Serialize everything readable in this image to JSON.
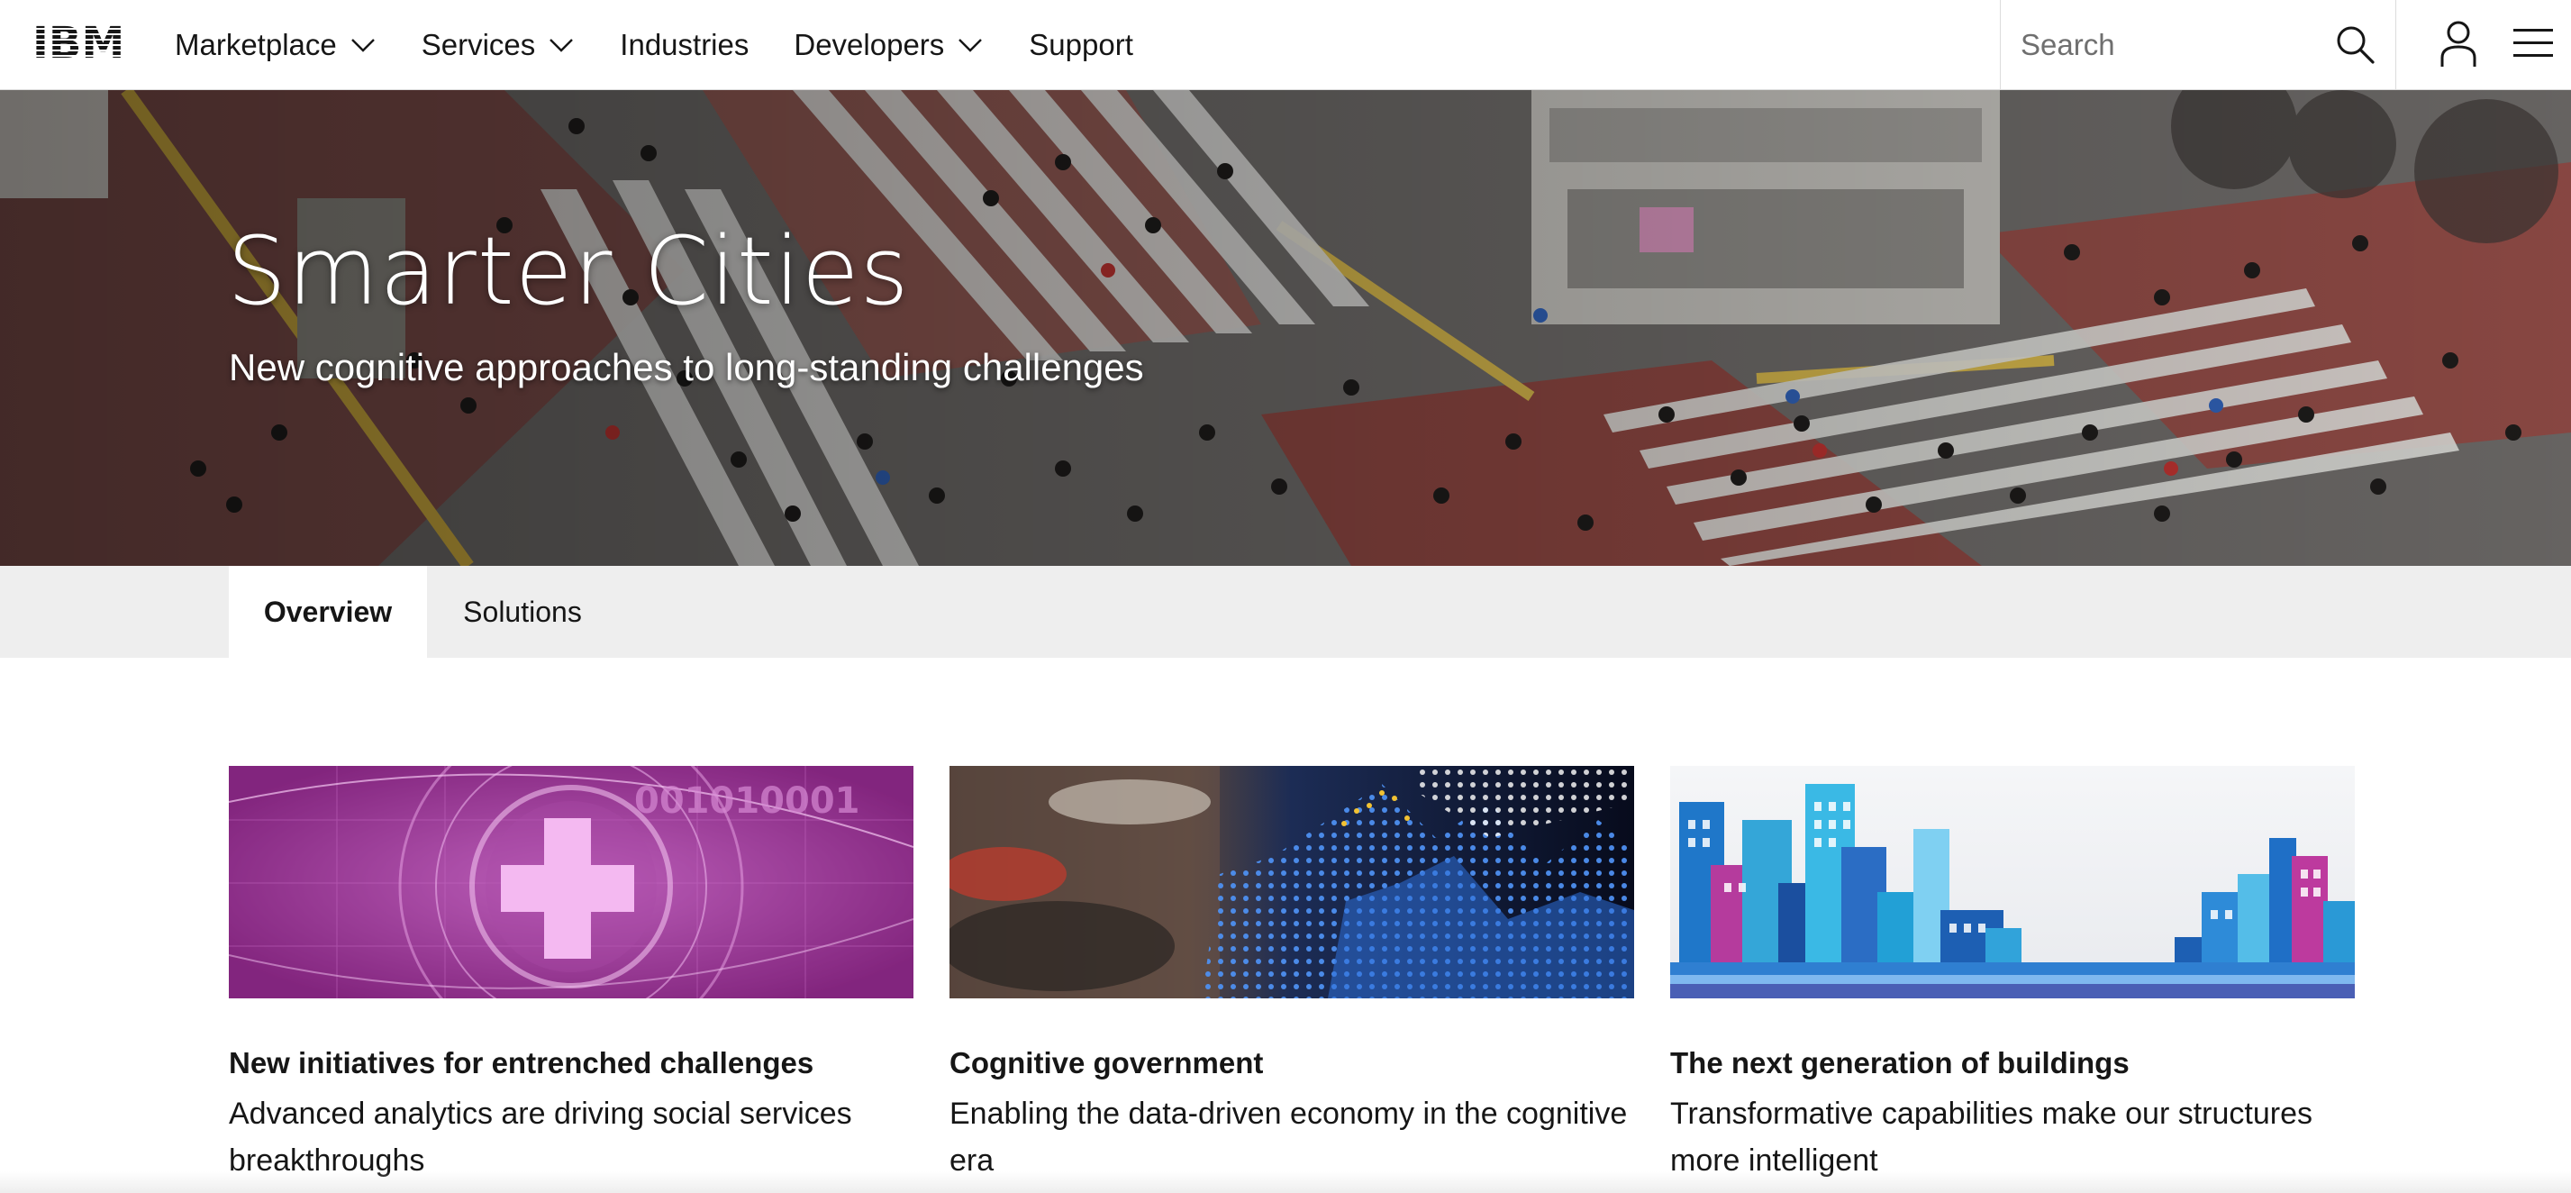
{
  "brand": {
    "logo_text": "IBM"
  },
  "nav": {
    "items": [
      {
        "label": "Marketplace",
        "has_dropdown": true
      },
      {
        "label": "Services",
        "has_dropdown": true
      },
      {
        "label": "Industries",
        "has_dropdown": false
      },
      {
        "label": "Developers",
        "has_dropdown": true
      },
      {
        "label": "Support",
        "has_dropdown": false
      }
    ],
    "search_placeholder": "Search",
    "icons": [
      "search-icon",
      "user-icon",
      "hamburger-menu-icon",
      "chevron-down-icon"
    ]
  },
  "hero": {
    "title": "Smarter Cities",
    "subtitle": "New cognitive approaches to long-standing challenges"
  },
  "tabs": [
    {
      "label": "Overview",
      "active": true
    },
    {
      "label": "Solutions",
      "active": false
    }
  ],
  "cards": [
    {
      "title": "New initiatives for entrenched challenges",
      "description": "Advanced analytics are driving social services breakthroughs",
      "image_text": "001010001"
    },
    {
      "title": "Cognitive government",
      "description": "Enabling the data-driven economy in the cognitive era"
    },
    {
      "title": "The next generation of buildings",
      "description": "Transformative capabilities make our structures more intelligent"
    }
  ],
  "colors": {
    "text": "#161616",
    "tab_bar": "#eeeeee",
    "card1_purple": "#8e2a8a",
    "card2_blue": "#3b7cd8",
    "card3_cyan": "#2ab3e0"
  }
}
